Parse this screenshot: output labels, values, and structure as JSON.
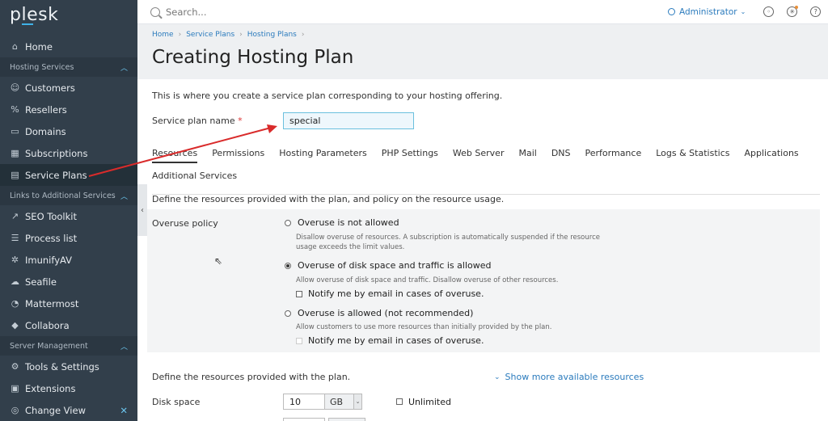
{
  "brand": {
    "logo": "plesk"
  },
  "sidebar": {
    "home": "Home",
    "groups": [
      {
        "label": "Hosting Services",
        "items": [
          "Customers",
          "Resellers",
          "Domains",
          "Subscriptions",
          "Service Plans"
        ]
      },
      {
        "label": "Links to Additional Services",
        "items": [
          "SEO Toolkit",
          "Process list",
          "ImunifyAV",
          "Seafile",
          "Mattermost",
          "Collabora"
        ]
      },
      {
        "label": "Server Management",
        "items": [
          "Tools & Settings",
          "Extensions",
          "Change View"
        ]
      }
    ],
    "active_item": "Service Plans"
  },
  "topbar": {
    "search_placeholder": "Search...",
    "user": "Administrator"
  },
  "breadcrumb": [
    "Home",
    "Service Plans",
    "Hosting Plans"
  ],
  "page_title": "Creating Hosting Plan",
  "intro": "This is where you create a service plan corresponding to your hosting offering.",
  "plan_name": {
    "label": "Service plan name",
    "required_mark": "*",
    "value": "special"
  },
  "tabs": [
    "Resources",
    "Permissions",
    "Hosting Parameters",
    "PHP Settings",
    "Web Server",
    "Mail",
    "DNS",
    "Performance",
    "Logs & Statistics",
    "Applications",
    "Additional Services"
  ],
  "active_tab": "Resources",
  "resources": {
    "define_policy": "Define the resources provided with the plan, and policy on the resource usage.",
    "overuse_label": "Overuse policy",
    "options": [
      {
        "label": "Overuse is not allowed",
        "desc": "Disallow overuse of resources. A subscription is automatically suspended if the resource usage exceeds the limit values.",
        "selected": false
      },
      {
        "label": "Overuse of disk space and traffic is allowed",
        "desc": "Allow overuse of disk space and traffic. Disallow overuse of other resources.",
        "selected": true,
        "notify": "Notify me by email in cases of overuse."
      },
      {
        "label": "Overuse is allowed (not recommended)",
        "desc": "Allow customers to use more resources than initially provided by the plan.",
        "selected": false,
        "notify": "Notify me by email in cases of overuse."
      }
    ],
    "define_resources": "Define the resources provided with the plan.",
    "show_more": "Show more available resources",
    "disk_space": {
      "label": "Disk space",
      "value": "10",
      "unit": "GB",
      "unlimited_label": "Unlimited"
    }
  },
  "colors": {
    "sidebar_bg": "#323f4b",
    "accent": "#2b7bbd",
    "annotation_arrow": "#d92b2b"
  }
}
